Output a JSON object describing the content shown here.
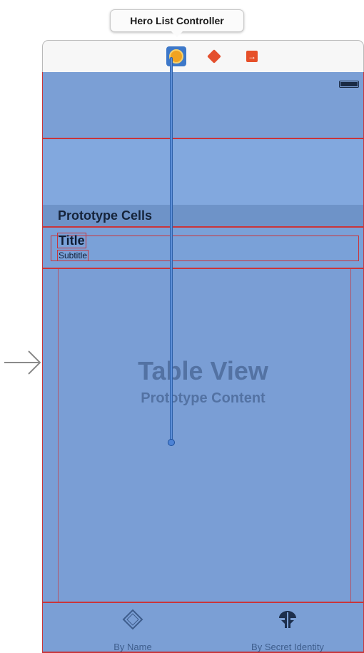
{
  "tooltip": {
    "text": "Hero List Controller"
  },
  "dock": {
    "icons": [
      "view-controller-icon",
      "first-responder-icon",
      "exit-icon"
    ]
  },
  "scene": {
    "section_header": "Prototype Cells",
    "cell": {
      "title": "Title",
      "subtitle": "Subtitle"
    },
    "placeholder": {
      "title": "Table View",
      "subtitle": "Prototype Content"
    },
    "tabbar": {
      "tabs": [
        {
          "label": "By Name",
          "icon": "name-badge-icon"
        },
        {
          "label": "By Secret Identity",
          "icon": "secret-identity-icon"
        }
      ]
    }
  },
  "colors": {
    "scene_background": "#7ba1d7",
    "constraint_red": "#c9353a",
    "selection_blue": "#3d78c9"
  }
}
